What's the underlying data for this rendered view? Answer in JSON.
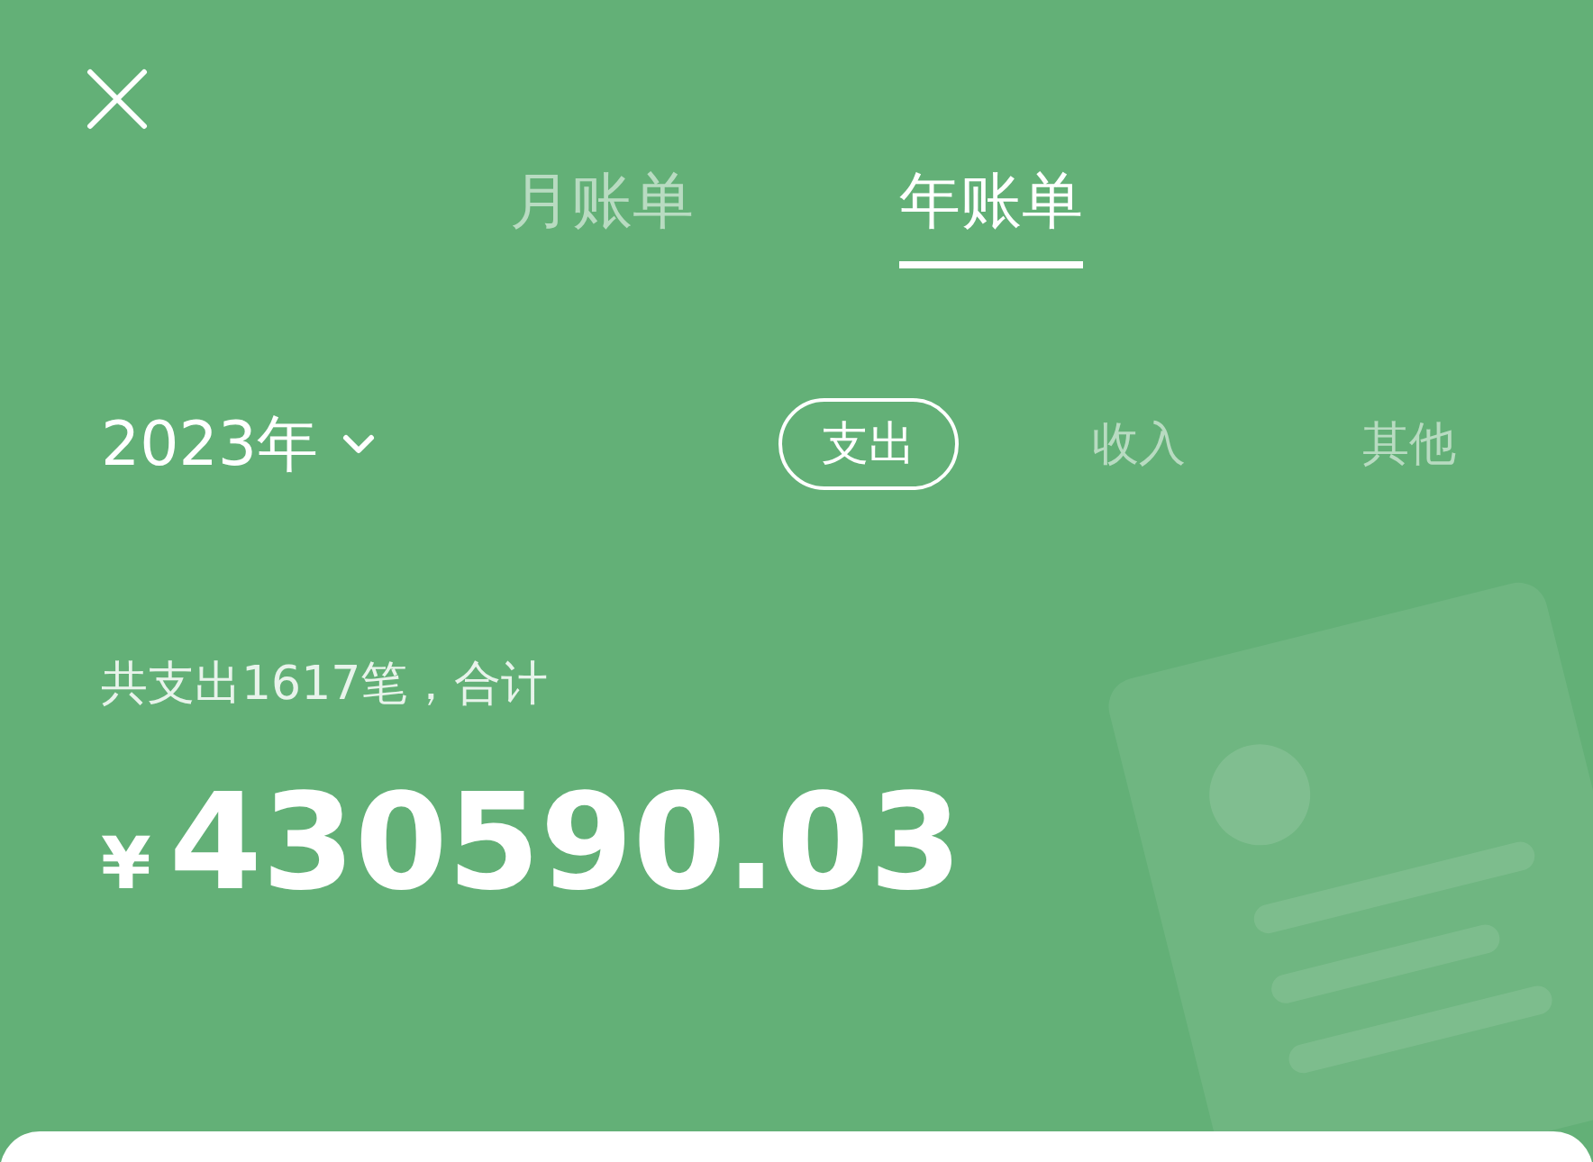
{
  "tabs": [
    {
      "label": "月账单",
      "selected": false
    },
    {
      "label": "年账单",
      "selected": true
    }
  ],
  "year_selector": {
    "label": "2023年"
  },
  "filters": [
    {
      "label": "支出",
      "selected": true
    },
    {
      "label": "收入",
      "selected": false
    },
    {
      "label": "其他",
      "selected": false
    }
  ],
  "summary": {
    "text": "共支出1617笔，合计",
    "currency": "¥",
    "amount": "430590.03"
  }
}
